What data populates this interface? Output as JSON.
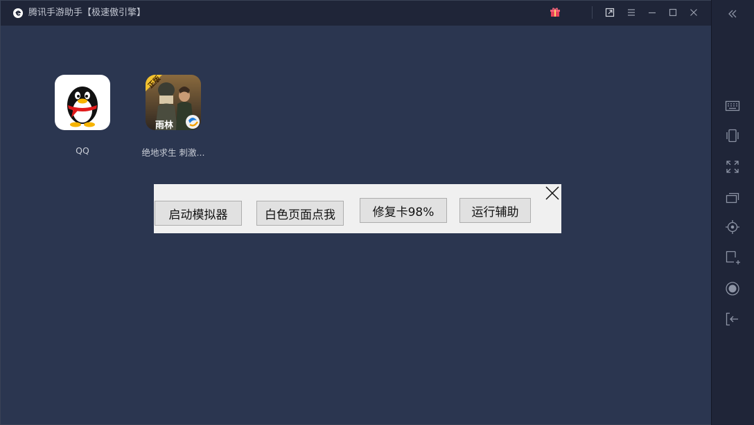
{
  "window": {
    "title": "腾讯手游助手【极速傲引擎】"
  },
  "titlebar": {
    "icons": [
      "gift-icon",
      "popout-icon",
      "menu-icon",
      "minimize-icon",
      "maximize-icon",
      "close-icon"
    ]
  },
  "sidebar": {
    "icons": [
      "collapse-icon",
      "keyboard-icon",
      "shake-icon",
      "fullscreen-icon",
      "multi-window-icon",
      "locate-icon",
      "screenshot-icon",
      "record-icon",
      "exit-icon"
    ]
  },
  "desktop": {
    "apps": [
      {
        "label": "QQ",
        "icon": "qq-penguin-icon"
      },
      {
        "label": "绝地求生 刺激...",
        "icon": "pubg-game-icon",
        "badge": "正版",
        "sub_badge": "雨林"
      }
    ]
  },
  "dialog": {
    "buttons": [
      {
        "label": "启动模拟器"
      },
      {
        "label": "白色页面点我"
      },
      {
        "label": "修复卡98%"
      },
      {
        "label": "运行辅助"
      }
    ]
  },
  "colors": {
    "background": "#2b3650",
    "titlebar": "#1f2538",
    "dialog_bg": "#f0f0f0",
    "button_bg": "#e1e1e1",
    "gift_accent": "#e8405a"
  }
}
